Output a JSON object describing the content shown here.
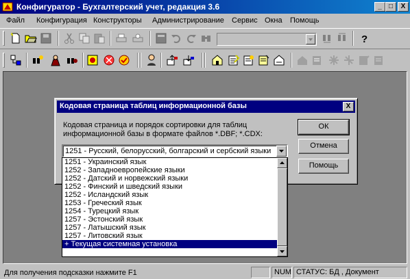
{
  "window": {
    "title": "Конфигуратор - Бухгалтерский учет, редакция 3.6",
    "minimize": "_",
    "maximize": "□",
    "close": "X"
  },
  "menu": [
    "Файл",
    "Конфигурация",
    "Конструкторы",
    "Администрирование",
    "Сервис",
    "Окна",
    "Помощь"
  ],
  "toolbar": {
    "icons_row1": [
      "new-icon",
      "open-icon",
      "save-icon",
      "cut-icon",
      "copy-icon",
      "paste-icon",
      "print-icon",
      "print-preview-icon",
      "properties-icon",
      "undo-icon",
      "redo-icon",
      "find-icon",
      "find-next-icon",
      "find-prev-icon",
      "help-icon"
    ],
    "icons_row2": [
      "metadata-icon",
      "find-user-icon",
      "user-icon",
      "users-icon",
      "debug-icon",
      "stop-icon",
      "monitor-icon",
      "user-settings-icon",
      "upload-icon",
      "download-icon",
      "module1-icon",
      "module2-icon",
      "module3-icon",
      "module4-icon",
      "module5-icon",
      "disabled1-icon",
      "disabled2-icon",
      "disabled3-icon",
      "disabled4-icon",
      "disabled5-icon",
      "disabled6-icon"
    ]
  },
  "dialog": {
    "title": "Кодовая страница таблиц информационной базы",
    "close": "X",
    "description": "Кодовая страница и порядок сортировки для таблиц информационной базы в формате файлов *.DBF; *.CDX:",
    "combo_value": "1251 - Русский, белорусский, болгарский и сербский языки",
    "buttons": {
      "ok": "ОК",
      "cancel": "Отмена",
      "help": "Помощь"
    }
  },
  "dropdown": {
    "items": [
      "1251 - Украинский язык",
      "1252 - Западноевропейские языки",
      "1252 - Датский и норвежский языки",
      "1252 - Финский и шведский языки",
      "1252 - Исландский язык",
      "1253 - Греческий язык",
      "1254 - Турецкий язык",
      "1257 - Эстонский язык",
      "1257 - Латышский язык",
      "1257 - Литовский язык",
      "+ Текущая системная установка"
    ],
    "selected_index": 10
  },
  "status": {
    "hint": "Для получения подсказки нажмите F1",
    "num": "NUM",
    "state": "СТАТУС: БД , Документ"
  }
}
